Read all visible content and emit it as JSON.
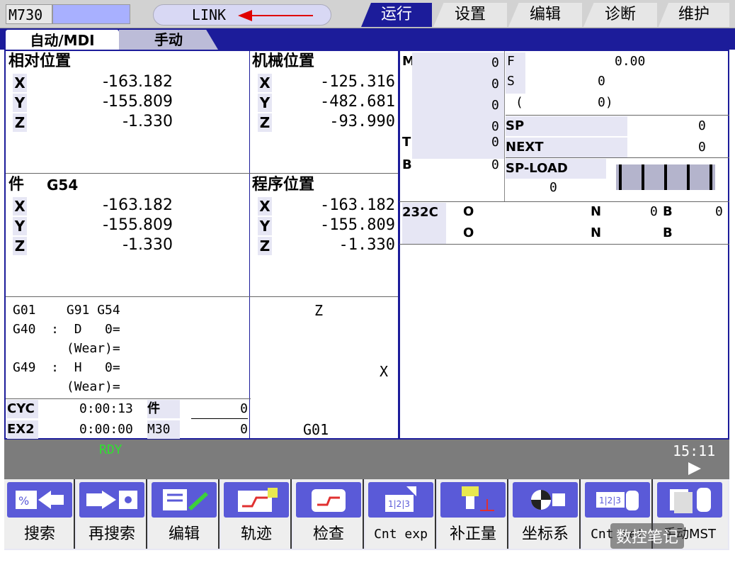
{
  "top": {
    "model": "M730",
    "link": "LINK",
    "tabs": [
      "运行",
      "设置",
      "编辑",
      "诊断",
      "维护"
    ],
    "active_tab": "运行"
  },
  "subtabs": {
    "auto": "自动/MDI",
    "manual": "手动"
  },
  "relative": {
    "title": "相对位置",
    "rows": [
      {
        "axis": "X",
        "value": "-163.182"
      },
      {
        "axis": "Y",
        "value": "-155.809"
      },
      {
        "axis": "Z",
        "value": "-1.330"
      }
    ]
  },
  "machine": {
    "title": "机械位置",
    "rows": [
      {
        "axis": "X",
        "value": "-125.316"
      },
      {
        "axis": "Y",
        "value": "-482.681"
      },
      {
        "axis": "Z",
        "value": "-93.990"
      }
    ]
  },
  "work": {
    "title": "件",
    "code": "G54",
    "rows": [
      {
        "axis": "X",
        "value": "-163.182"
      },
      {
        "axis": "Y",
        "value": "-155.809"
      },
      {
        "axis": "Z",
        "value": "-1.330"
      }
    ]
  },
  "program": {
    "title": "程序位置",
    "rows": [
      {
        "axis": "X",
        "value": "-163.182"
      },
      {
        "axis": "Y",
        "value": "-155.809"
      },
      {
        "axis": "Z",
        "value": "-1.330"
      }
    ]
  },
  "modal": {
    "line1": "G01    G91 G54",
    "line2": "G40  :  D   0=",
    "line3": "       (Wear)=",
    "line4": "G49  :  H   0=",
    "line5": "       (Wear)="
  },
  "counters": {
    "cyc_label": "CYC",
    "cyc_time": "0:00:13",
    "ex2_label": "EX2",
    "ex2_time": "0:00:00",
    "part_label": "件",
    "part_value": "0",
    "m30_label": "M30",
    "m30_value": "0"
  },
  "graphic": {
    "z": "Z",
    "x": "X",
    "g": "G01"
  },
  "mst": {
    "m_label": "M",
    "m_values": [
      "0",
      "0",
      "0",
      "0"
    ],
    "t_label": "T",
    "t_value": "0",
    "b_label": "B",
    "b_value": "0",
    "f_label": "F",
    "f_value": "0.00",
    "s_label": "S",
    "s_value": "0",
    "paren_open": "(",
    "paren_value": "0)",
    "sp_label": "SP",
    "sp_value": "0",
    "next_label": "NEXT",
    "next_value": "0",
    "spload_label": "SP-LOAD",
    "spload_value": "0"
  },
  "rs232": {
    "label": "232C",
    "o1": "O",
    "n1": "N",
    "n1_val": "0",
    "b1": "B",
    "b1_val": "0",
    "o2": "O",
    "n2": "N",
    "b2": "B"
  },
  "status": {
    "rdy": "RDY",
    "clock": "15:11"
  },
  "fkeys": [
    "搜索",
    "再搜索",
    "编辑",
    "轨迹",
    "检查",
    "Cnt exp",
    "补正量",
    "坐标系",
    "Cnt set",
    "手动MST"
  ],
  "watermark": "数控笔记",
  "colors": {
    "panel_blue": "#1c1c9a",
    "label_bg": "#e6e6f4",
    "rdy_green": "#30e030",
    "status_gray": "#7c7c7c"
  }
}
